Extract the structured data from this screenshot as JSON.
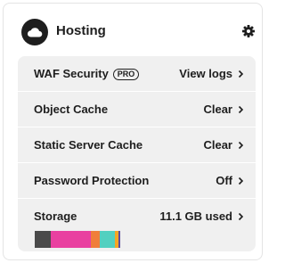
{
  "header": {
    "title": "Hosting",
    "logo_icon": "cloud-icon",
    "settings_icon": "gear-icon"
  },
  "rows": [
    {
      "label": "WAF Security",
      "badge": "PRO",
      "value": "View logs"
    },
    {
      "label": "Object Cache",
      "value": "Clear"
    },
    {
      "label": "Static Server Cache",
      "value": "Clear"
    },
    {
      "label": "Password Protection",
      "value": "Off"
    },
    {
      "label": "Storage",
      "value": "11.1 GB used"
    }
  ],
  "storage_breakdown": [
    {
      "color": "#4a4a4a",
      "share": 0.185
    },
    {
      "color": "#e940a0",
      "share": 0.46
    },
    {
      "color": "#f07e3a",
      "share": 0.1
    },
    {
      "color": "#52d0c0",
      "share": 0.175
    },
    {
      "color": "#f5a623",
      "share": 0.04
    },
    {
      "color": "#5d4e9d",
      "share": 0.02
    },
    {
      "color": "#f0f0f0",
      "share": 0.02
    }
  ]
}
